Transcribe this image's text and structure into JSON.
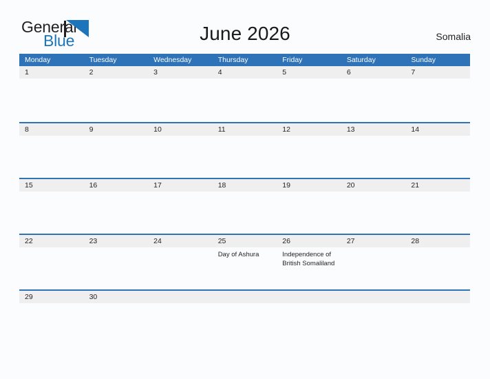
{
  "logo": {
    "word1": "General",
    "word2": "Blue",
    "triangle_color": "#1c74bb",
    "text_color": "#231f20"
  },
  "header": {
    "title": "June 2026",
    "country": "Somalia"
  },
  "colors": {
    "header_blue": "#2e72b8",
    "band_gray": "#efefef",
    "page_bg": "#fafcfd",
    "text": "#231f20"
  },
  "calendar": {
    "weekday_labels": [
      "Monday",
      "Tuesday",
      "Wednesday",
      "Thursday",
      "Friday",
      "Saturday",
      "Sunday"
    ],
    "weeks": [
      {
        "days": [
          {
            "num": "1",
            "events": []
          },
          {
            "num": "2",
            "events": []
          },
          {
            "num": "3",
            "events": []
          },
          {
            "num": "4",
            "events": []
          },
          {
            "num": "5",
            "events": []
          },
          {
            "num": "6",
            "events": []
          },
          {
            "num": "7",
            "events": []
          }
        ]
      },
      {
        "days": [
          {
            "num": "8",
            "events": []
          },
          {
            "num": "9",
            "events": []
          },
          {
            "num": "10",
            "events": []
          },
          {
            "num": "11",
            "events": []
          },
          {
            "num": "12",
            "events": []
          },
          {
            "num": "13",
            "events": []
          },
          {
            "num": "14",
            "events": []
          }
        ]
      },
      {
        "days": [
          {
            "num": "15",
            "events": []
          },
          {
            "num": "16",
            "events": []
          },
          {
            "num": "17",
            "events": []
          },
          {
            "num": "18",
            "events": []
          },
          {
            "num": "19",
            "events": []
          },
          {
            "num": "20",
            "events": []
          },
          {
            "num": "21",
            "events": []
          }
        ]
      },
      {
        "days": [
          {
            "num": "22",
            "events": []
          },
          {
            "num": "23",
            "events": []
          },
          {
            "num": "24",
            "events": []
          },
          {
            "num": "25",
            "events": [
              "Day of Ashura"
            ]
          },
          {
            "num": "26",
            "events": [
              "Independence of British Somaliland"
            ]
          },
          {
            "num": "27",
            "events": []
          },
          {
            "num": "28",
            "events": []
          }
        ]
      },
      {
        "days": [
          {
            "num": "29",
            "events": []
          },
          {
            "num": "30",
            "events": []
          },
          {
            "num": "",
            "events": []
          },
          {
            "num": "",
            "events": []
          },
          {
            "num": "",
            "events": []
          },
          {
            "num": "",
            "events": []
          },
          {
            "num": "",
            "events": []
          }
        ]
      }
    ]
  }
}
